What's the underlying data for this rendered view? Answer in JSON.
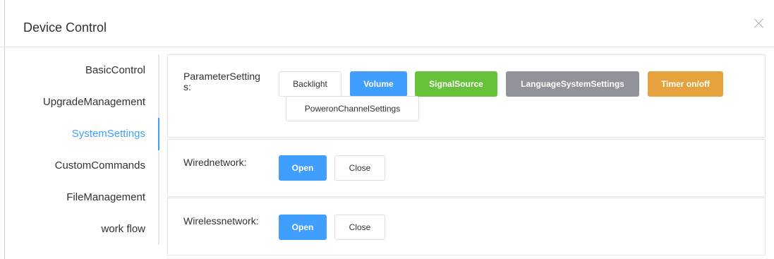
{
  "dialog": {
    "title": "Device Control",
    "close_icon": "close-icon"
  },
  "tabs": [
    {
      "label": "BasicControl",
      "active": false
    },
    {
      "label": "UpgradeManagement",
      "active": false
    },
    {
      "label": "SystemSettings",
      "active": true
    },
    {
      "label": "CustomCommands",
      "active": false
    },
    {
      "label": "FileManagement",
      "active": false
    },
    {
      "label": "work flow",
      "active": false
    }
  ],
  "parameter_settings": {
    "label_line1": "ParameterSetting",
    "label_line2": "s:",
    "buttons": {
      "backlight": "Backlight",
      "volume": "Volume",
      "signal_source": "SignalSource",
      "language_system_settings": "LanguageSystemSettings",
      "timer_on_off": "Timer on/off",
      "poweron_channel_settings": "PoweronChannelSettings"
    }
  },
  "wired_network": {
    "label": "Wirednetwork:",
    "open": "Open",
    "close": "Close"
  },
  "wireless_network": {
    "label": "Wirelessnetwork:",
    "open": "Open",
    "close": "Close"
  },
  "colors": {
    "primary": "#409eff",
    "success": "#67c23a",
    "info": "#909399",
    "warning": "#e6a23c"
  }
}
